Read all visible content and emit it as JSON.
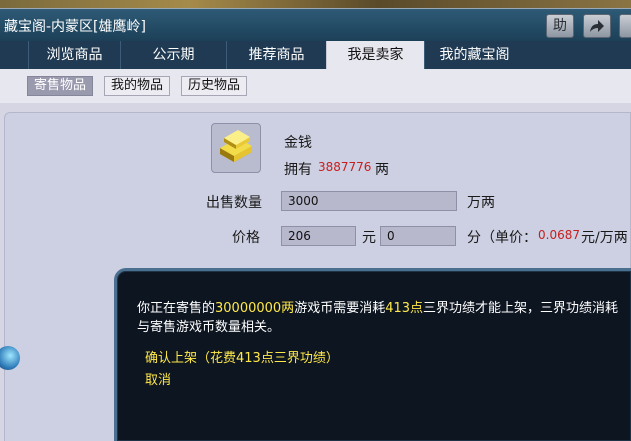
{
  "window": {
    "title": "藏宝阁-内蒙区[雄鹰岭]",
    "help_button": "助",
    "share_icon": "share-arrow-icon"
  },
  "tabs": [
    {
      "label": "浏览商品",
      "active": false
    },
    {
      "label": "公示期",
      "active": false
    },
    {
      "label": "推荐商品",
      "active": false
    },
    {
      "label": "我是卖家",
      "active": true
    },
    {
      "label": "我的藏宝阁",
      "active": false
    }
  ],
  "subtabs": [
    {
      "label": "寄售物品",
      "active": true
    },
    {
      "label": "我的物品",
      "active": false
    },
    {
      "label": "历史物品",
      "active": false
    }
  ],
  "item": {
    "icon": "gold-ingot-icon",
    "name": "金钱",
    "owned_prefix": "拥有",
    "owned_amount": "3887776",
    "owned_unit": "两"
  },
  "form": {
    "quantity_label": "出售数量",
    "quantity_value": "3000",
    "quantity_unit": "万两",
    "price_label": "价格",
    "price_yuan": "206",
    "yuan_unit": "元",
    "price_fen": "0",
    "fen_unit": "分（单价：",
    "unit_price": "0.0687",
    "unit_price_suffix": "元/万两"
  },
  "dialog": {
    "msg_part1": "你正在寄售的",
    "msg_amount": "30000000两",
    "msg_part2": "游戏币需要消耗",
    "msg_points": "413点",
    "msg_part3": "三界功绩才能上架，三界功绩消耗",
    "msg_line2": "与寄售游戏币数量相关。",
    "confirm_label": "确认上架（花费413点三界功绩）",
    "cancel_label": "取消"
  }
}
